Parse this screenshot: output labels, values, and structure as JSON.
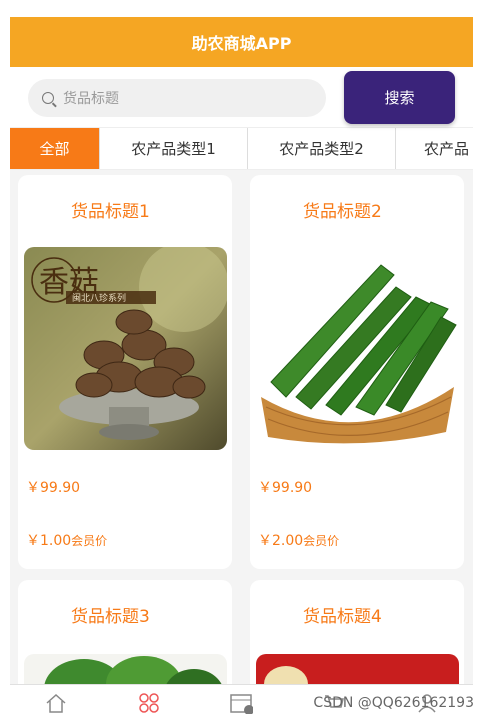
{
  "app": {
    "title": "助农商城APP"
  },
  "search": {
    "placeholder": "货品标题",
    "button_label": "搜索"
  },
  "tabs": [
    {
      "label": "全部",
      "active": true
    },
    {
      "label": "农产品类型1"
    },
    {
      "label": "农产品类型2"
    },
    {
      "label": "农产品"
    }
  ],
  "products": [
    {
      "title": "货品标题1",
      "price": "￥99.90",
      "member_price": "￥1.00",
      "member_label": "会员价",
      "image": "shiitake-mushrooms",
      "image_text": {
        "main": "香菇",
        "sub": "闽北八珍系列"
      }
    },
    {
      "title": "货品标题2",
      "price": "￥99.90",
      "member_price": "￥2.00",
      "member_label": "会员价",
      "image": "cucumbers-basket"
    },
    {
      "title": "货品标题3",
      "image": "leafy-greens"
    },
    {
      "title": "货品标题4",
      "image": "red-background-dog"
    }
  ],
  "tabbar": {
    "items": [
      "home-icon",
      "category-icon",
      "calendar-icon",
      "cart-icon",
      "user-icon"
    ]
  },
  "watermark": "CSDN @QQ626162193",
  "colors": {
    "header": "#f5a623",
    "accent": "#f77a17",
    "search_button": "#3a237a"
  }
}
